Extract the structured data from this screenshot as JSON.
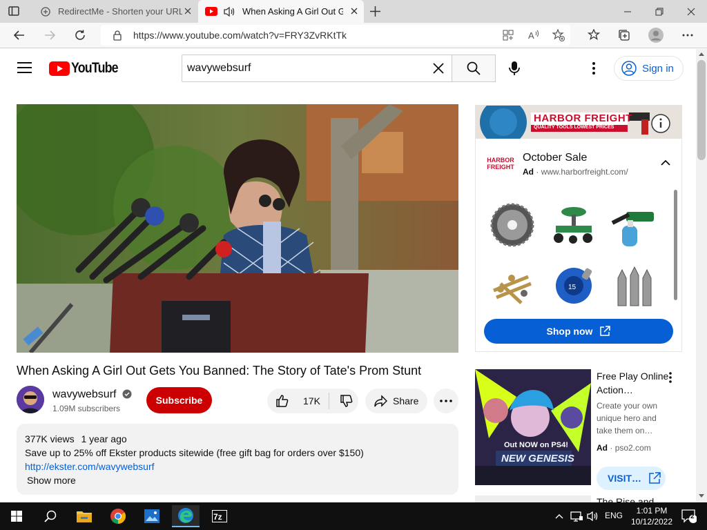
{
  "browser": {
    "tabs": [
      {
        "title": "RedirectMe - Shorten your URL f",
        "active": false
      },
      {
        "title": "When Asking A Girl Out Gets",
        "active": true
      }
    ],
    "url": "https://www.youtube.com/watch?v=FRY3ZvRKtTk"
  },
  "youtube": {
    "logo_text": "YouTube",
    "search_value": "wavywebsurf",
    "sign_in_label": "Sign in"
  },
  "video": {
    "title": "When Asking A Girl Out Gets You Banned: The Story of Tate's Prom Stunt",
    "channel": "wavywebsurf",
    "subscribers": "1.09M subscribers",
    "subscribe_label": "Subscribe",
    "likes": "17K",
    "share_label": "Share",
    "views": "377K views",
    "age": "1 year ago",
    "description_line": "Save up to 25% off Ekster products sitewide (free gift bag for orders over $150)",
    "description_link": "http://ekster.com/wavywebsurf",
    "show_more_label": "Show more"
  },
  "ad_top": {
    "banner_brand": "HARBOR FREIGHT",
    "banner_tagline": "QUALITY TOOLS LOWEST PRICES",
    "logo_line1": "HARBOR",
    "logo_line2": "FREIGHT",
    "title": "October Sale",
    "ad_label": "Ad",
    "domain": "www.harborfreight.com/",
    "cta": "Shop now"
  },
  "ad_side": {
    "title": "Free Play Online Action…",
    "description": "Create your own unique hero and take them on…",
    "ad_label": "Ad",
    "domain": "pso2.com",
    "cta": "VISIT…",
    "thumb_text": "Out NOW on PS4!",
    "thumb_logo": "NEW GENESIS"
  },
  "next_video": {
    "title": "The Rise and"
  },
  "taskbar": {
    "language": "ENG",
    "time": "1:01 PM",
    "date": "10/12/2022",
    "notifications": "2"
  }
}
